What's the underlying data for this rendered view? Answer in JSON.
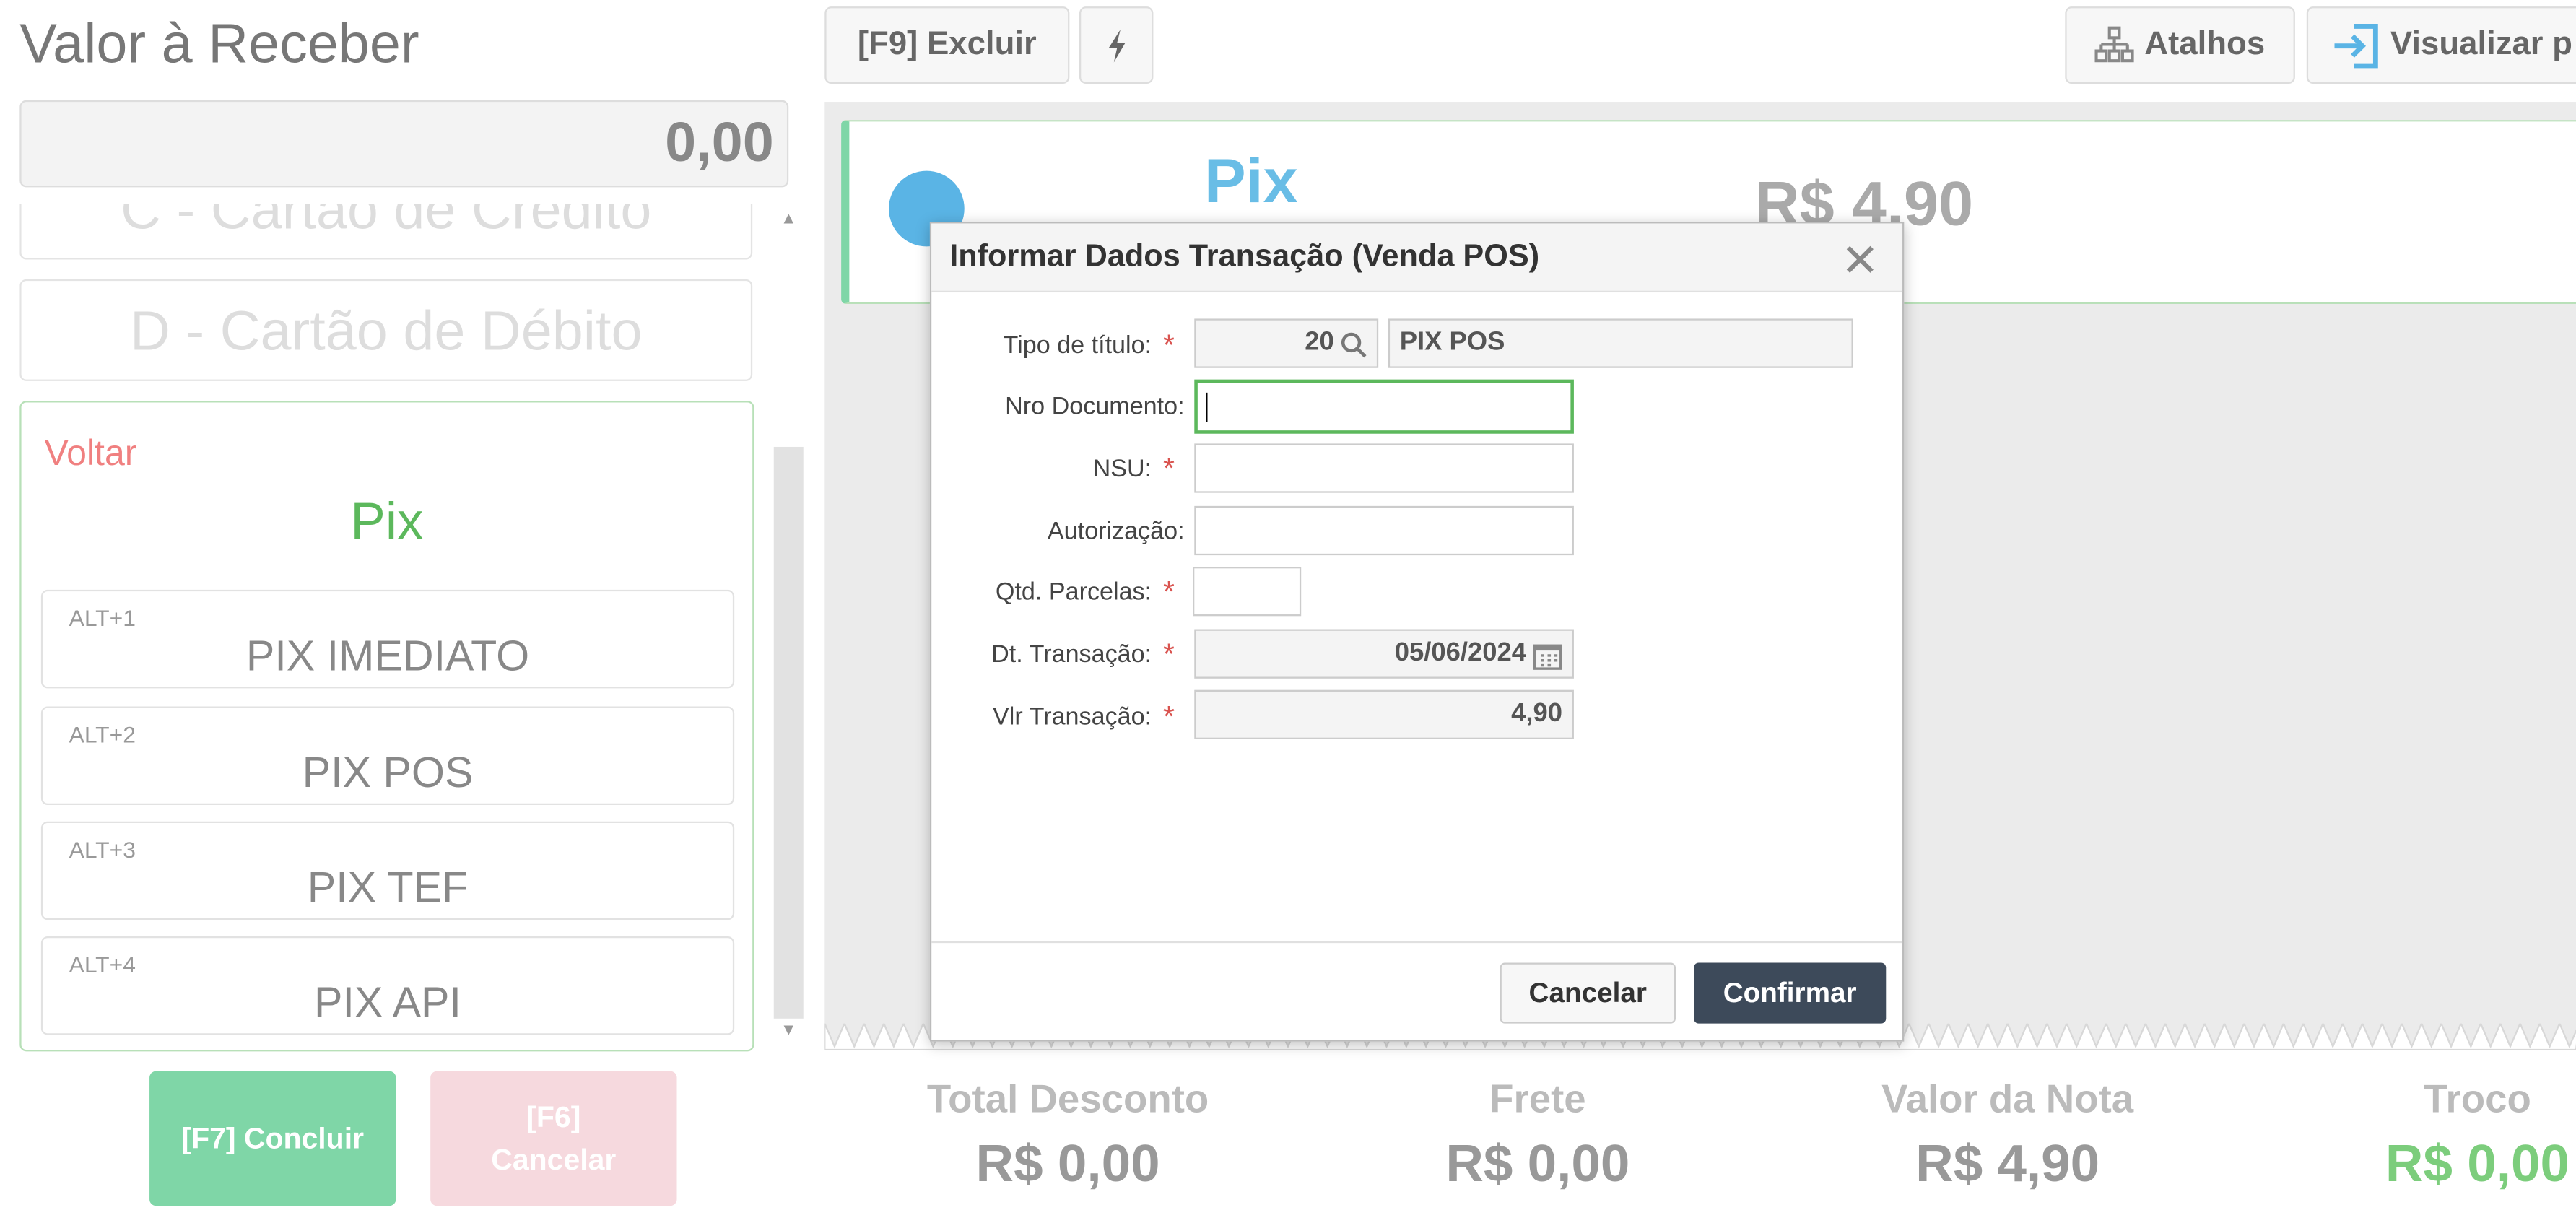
{
  "header": {
    "title": "Valor à Receber",
    "amount": "0,00"
  },
  "toolbar": {
    "excluir_label": "[F9] Excluir",
    "atalhos_label": "Atalhos",
    "visualizar_label": "Visualizar p"
  },
  "payment_methods": {
    "credito_label": "C - Cartão de Crédito",
    "debito_label": "D - Cartão de Débito"
  },
  "pix_panel": {
    "back_label": "Voltar",
    "title": "Pix",
    "options": [
      {
        "shortcut": "ALT+1",
        "label": "PIX IMEDIATO"
      },
      {
        "shortcut": "ALT+2",
        "label": "PIX POS"
      },
      {
        "shortcut": "ALT+3",
        "label": "PIX TEF"
      },
      {
        "shortcut": "ALT+4",
        "label": "PIX API"
      }
    ]
  },
  "actions": {
    "concluir_label": "[F7] Concluir",
    "cancelar_line1": "[F6]",
    "cancelar_line2": "Cancelar"
  },
  "payment_card": {
    "method": "Pix",
    "value": "R$ 4,90"
  },
  "totals": [
    {
      "label": "Total Desconto",
      "value": "R$ 0,00"
    },
    {
      "label": "Frete",
      "value": "R$ 0,00"
    },
    {
      "label": "Valor da Nota",
      "value": "R$ 4,90"
    },
    {
      "label": "Troco",
      "value": "R$ 0,00"
    }
  ],
  "modal": {
    "title": "Informar Dados Transação (Venda POS)",
    "fields": {
      "tipo_label": "Tipo de título:",
      "tipo_code": "20",
      "tipo_desc": "PIX POS",
      "nro_label": "Nro Documento:",
      "nro_value": "",
      "nsu_label": "NSU:",
      "nsu_value": "",
      "autorizacao_label": "Autorização:",
      "autorizacao_value": "",
      "parcelas_label": "Qtd. Parcelas:",
      "parcelas_value": "",
      "dt_label": "Dt. Transação:",
      "dt_value": "05/06/2024",
      "vlr_label": "Vlr Transação:",
      "vlr_value": "4,90"
    },
    "cancel_label": "Cancelar",
    "confirm_label": "Confirmar"
  },
  "colors": {
    "accent_green": "#7fd6a7",
    "pix_blue": "#69bde6",
    "confirm_dark": "#3d4a5a",
    "troco_green": "#7ccd7c"
  },
  "icons": [
    "bolt-icon",
    "sitemap-icon",
    "sign-in-icon",
    "search-icon",
    "calendar-icon",
    "close-icon"
  ]
}
